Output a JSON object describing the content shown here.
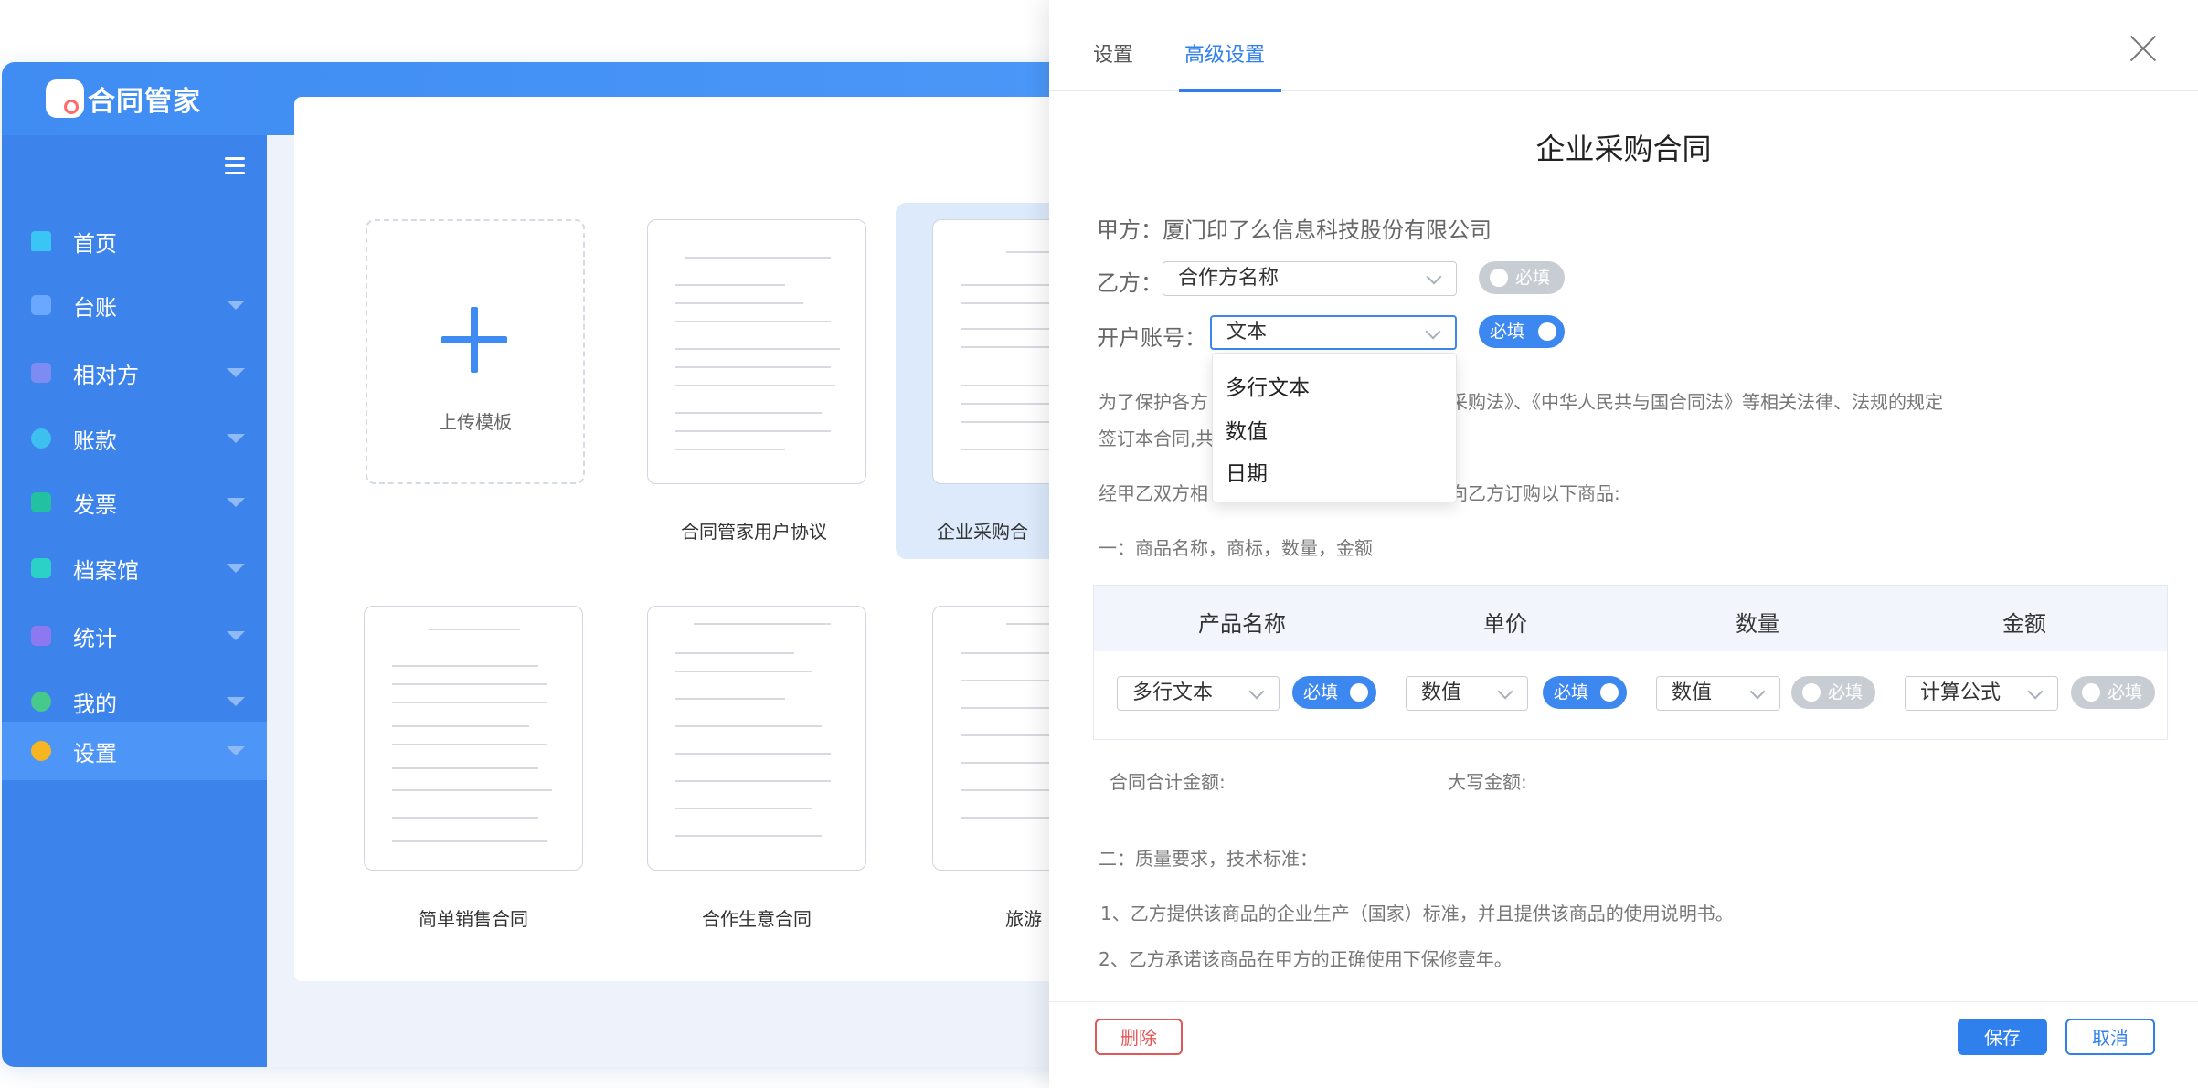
{
  "app": {
    "logo_text": "合同管家",
    "nav": [
      {
        "label": "首页",
        "icon": "home-icon",
        "color": "#39c6f4",
        "has_caret": false
      },
      {
        "label": "台账",
        "icon": "ledger-icon",
        "color": "#6aa8ff",
        "has_caret": true
      },
      {
        "label": "相对方",
        "icon": "contacts-icon",
        "color": "#7c8cf3",
        "has_caret": true
      },
      {
        "label": "账款",
        "icon": "yen-icon",
        "color": "#3ec0ef",
        "has_caret": true
      },
      {
        "label": "发票",
        "icon": "invoice-icon",
        "color": "#22c1a0",
        "has_caret": true
      },
      {
        "label": "档案馆",
        "icon": "folder-icon",
        "color": "#2bd0c7",
        "has_caret": true
      },
      {
        "label": "统计",
        "icon": "chart-icon",
        "color": "#8c79f0",
        "has_caret": true
      },
      {
        "label": "我的",
        "icon": "user-icon",
        "color": "#46c98a",
        "has_caret": true
      },
      {
        "label": "设置",
        "icon": "settings-icon",
        "color": "#f6b521",
        "has_caret": true
      }
    ],
    "templates": {
      "upload_label": "上传模板",
      "cards": [
        {
          "caption": "合同管家用户协议"
        },
        {
          "caption": "企业采购合"
        },
        {
          "caption": "简单销售合同"
        },
        {
          "caption": "合作生意合同"
        },
        {
          "caption": "旅游"
        }
      ]
    }
  },
  "panel": {
    "tabs": [
      "设置",
      "高级设置"
    ],
    "active_tab": "高级设置",
    "title": "企业采购合同",
    "party_a": "甲方：厦门印了么信息科技股份有限公司",
    "party_b_label": "乙方：",
    "party_b_select": "合作方名称",
    "account_label": "开户账号：",
    "account_select": "文本",
    "required_label": "必填",
    "dropdown_options": [
      "多行文本",
      "数值",
      "日期"
    ],
    "para1_left": "为了保护各方",
    "para1_right": "国政府采购法》、《中华人民共与国合同法》等相关法律、法规的规定",
    "para1_line2": "签订本合同,共",
    "para2_left": "经甲乙双方相",
    "para2_right": "由甲方向乙方订购以下商品:",
    "section1": "一：商品名称，商标，数量，金额",
    "table": {
      "headers": [
        "产品名称",
        "单价",
        "数量",
        "金额"
      ],
      "cells": [
        {
          "select": "多行文本",
          "required": true
        },
        {
          "select": "数值",
          "required": true
        },
        {
          "select": "数值",
          "required": false
        },
        {
          "select": "计算公式",
          "required": false
        }
      ]
    },
    "total_label": "合同合计金额:",
    "capital_label": "大写金额:",
    "section2": "二：质量要求，技术标准：",
    "item1": "1、乙方提供该商品的企业生产（国家）标准，并且提供该商品的使用说明书。",
    "item2": "2、乙方承诺该商品在甲方的正确使用下保修壹年。",
    "buttons": {
      "delete": "删除",
      "save": "保存",
      "cancel": "取消"
    }
  }
}
